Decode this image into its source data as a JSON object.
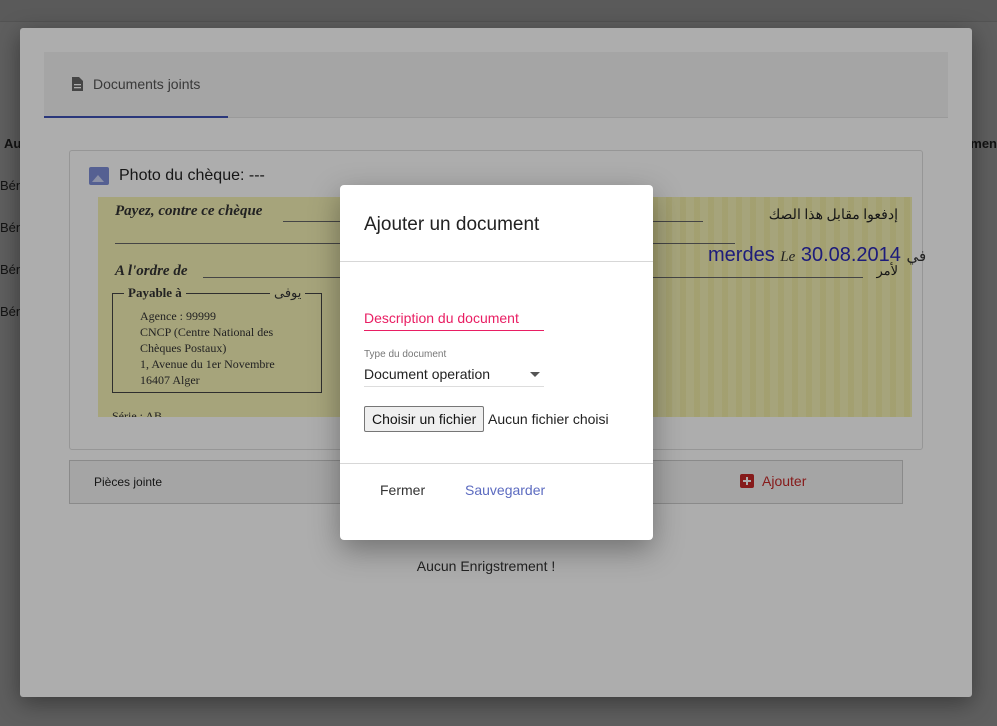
{
  "background": {
    "left_column_header": "Au",
    "left_column_rows": [
      "Bén",
      "Bén",
      "Bén",
      "Bén"
    ],
    "right_column_header": "men"
  },
  "dialog": {
    "tab_label": "Documents joints",
    "photo": {
      "title": "Photo du chèque: ---",
      "cheque_text": {
        "payez": "Payez, contre ce chèque",
        "payez_ar": "إدفعوا مقابل هذا الصك",
        "ordre": "A l'ordre de",
        "ordre_ar": "لأمر",
        "payable_label": "Payable à",
        "payable_ar": "يوفى",
        "payable_lines": [
          "Agence : 99999",
          "CNCP (Centre National des",
          "Chèques Postaux)",
          "1, Avenue du 1er Novembre",
          "16407 Alger"
        ],
        "serie": "Série : AB",
        "place": "merdes",
        "le": "Le",
        "date": "30.08.2014",
        "fi": "في"
      }
    },
    "pieces_label": "Pièces jointe",
    "add_label": "Ajouter",
    "empty_message": "Aucun Enrigstrement !"
  },
  "modal": {
    "title": "Ajouter un document",
    "description_placeholder": "Description du document",
    "type_label": "Type du document",
    "type_value": "Document operation",
    "file_button": "Choisir un fichier",
    "file_status": "Aucun fichier choisi",
    "close_label": "Fermer",
    "save_label": "Sauvegarder"
  },
  "colors": {
    "accent": "#3f51b5",
    "danger": "#c62828",
    "input_active": "#e91e63",
    "link": "#5c6bc0"
  }
}
